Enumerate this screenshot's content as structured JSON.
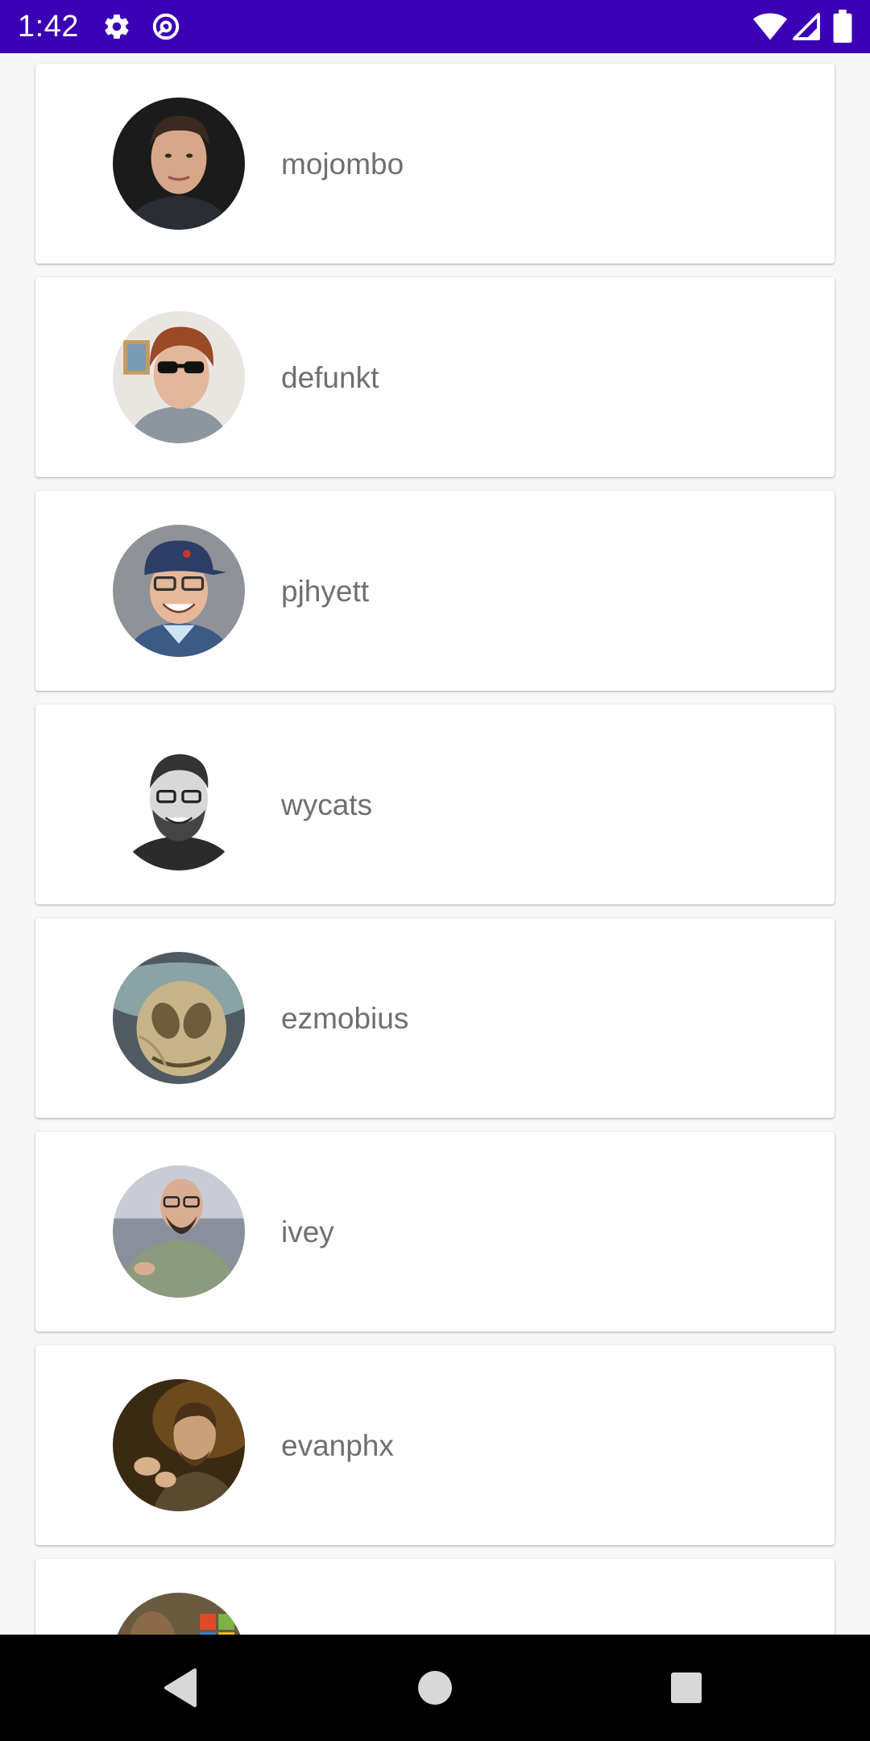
{
  "status_bar": {
    "time": "1:42",
    "background": "#3b00b4",
    "icons": [
      "gear-icon",
      "at-sign-icon",
      "wifi-icon",
      "signal-icon",
      "battery-icon"
    ]
  },
  "users": [
    {
      "login": "mojombo",
      "avatar": "avatar-photo"
    },
    {
      "login": "defunkt",
      "avatar": "avatar-photo"
    },
    {
      "login": "pjhyett",
      "avatar": "avatar-photo"
    },
    {
      "login": "wycats",
      "avatar": "avatar-photo"
    },
    {
      "login": "ezmobius",
      "avatar": "avatar-illustration"
    },
    {
      "login": "ivey",
      "avatar": "avatar-photo"
    },
    {
      "login": "evanphx",
      "avatar": "avatar-photo"
    },
    {
      "login": "",
      "avatar": "avatar-photo"
    }
  ],
  "nav_bar": {
    "buttons": [
      "back-icon",
      "home-icon",
      "recents-icon"
    ]
  }
}
